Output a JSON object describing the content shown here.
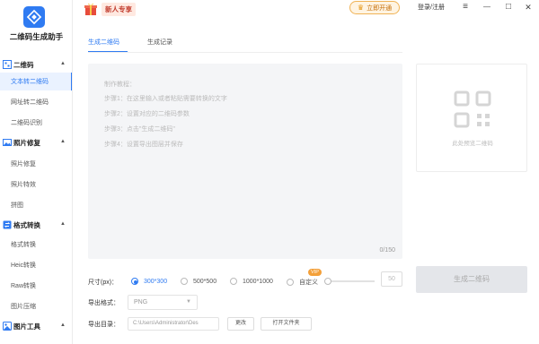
{
  "app": {
    "name": "二维码生成助手"
  },
  "topbar": {
    "new_user_label": "新人专享",
    "vip_label": "立即开通",
    "login_label": "登录/注册",
    "menu_icon": "≡",
    "minimize_icon": "—",
    "maximize_icon": "□",
    "close_icon": "✕"
  },
  "sidebar": {
    "sections": [
      {
        "title": "二维码",
        "items": [
          "文本转二维码",
          "网址转二维码",
          "二维码识别"
        ]
      },
      {
        "title": "照片修复",
        "items": [
          "照片修复",
          "照片特效",
          "拼图"
        ]
      },
      {
        "title": "格式转换",
        "items": [
          "格式转换",
          "Heic转换",
          "Raw转换",
          "图片压缩"
        ]
      },
      {
        "title": "图片工具",
        "items": []
      }
    ],
    "active_item": "文本转二维码"
  },
  "tabs": [
    {
      "label": "生成二维码",
      "active": true
    },
    {
      "label": "生成记录",
      "active": false
    }
  ],
  "editor": {
    "lines": [
      "制作教程：",
      "步骤1：在这里输入或者粘贴需要转换的文字",
      "步骤2：设置对应的二维码参数",
      "步骤3：点击\"生成二维码\"",
      "步骤4：设置导出图层并保存"
    ],
    "counter": "0/150"
  },
  "preview": {
    "placeholder": "此处预览二维码"
  },
  "options": {
    "size_label": "尺寸(px)：",
    "sizes": [
      "300*300",
      "500*500",
      "1000*1000",
      "自定义"
    ],
    "selected_size": "300*300",
    "vip_badge": "VIP",
    "custom_value": "50",
    "format_label": "导出格式：",
    "format_value": "PNG",
    "dir_label": "导出目录：",
    "dir_value": "C:\\Users\\Administrator\\Des",
    "change_label": "更改",
    "open_folder_label": "打开文件夹"
  },
  "generate_label": "生成二维码",
  "colors": {
    "accent": "#2f7bf2",
    "vip": "#f3a03a"
  }
}
